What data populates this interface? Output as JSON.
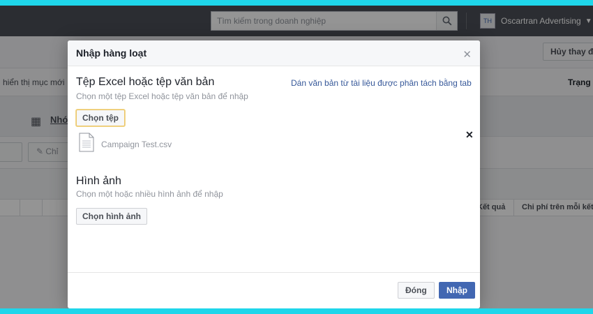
{
  "header": {
    "search_placeholder": "Tìm kiếm trong doanh nghiệp",
    "account_initials": "TH",
    "account_name": "Oscartran Advertising"
  },
  "background": {
    "discard_button": "Hủy thay đ",
    "filter_text": "hiển thị mục mới",
    "status_label": "Trạng",
    "tab_label": "Nhó",
    "edit_label": "Chỉ",
    "col_results": "Kết quả",
    "col_cost": "Chi phí trên mỗi kết"
  },
  "dialog": {
    "title": "Nhập hàng loạt",
    "excel_section": {
      "title": "Tệp Excel hoặc tệp văn bản",
      "subtitle": "Chọn một tệp Excel hoặc tệp văn bản để nhập",
      "choose_file_button": "Chọn tệp",
      "paste_link": "Dán văn bản từ tài liệu được phân tách bằng tab",
      "file_name": "Campaign Test.csv"
    },
    "image_section": {
      "title": "Hình ảnh",
      "subtitle": "Chọn một hoặc nhiều hình ảnh để nhập",
      "choose_image_button": "Chọn hình ảnh"
    },
    "footer": {
      "close_button": "Đóng",
      "import_button": "Nhập"
    }
  }
}
